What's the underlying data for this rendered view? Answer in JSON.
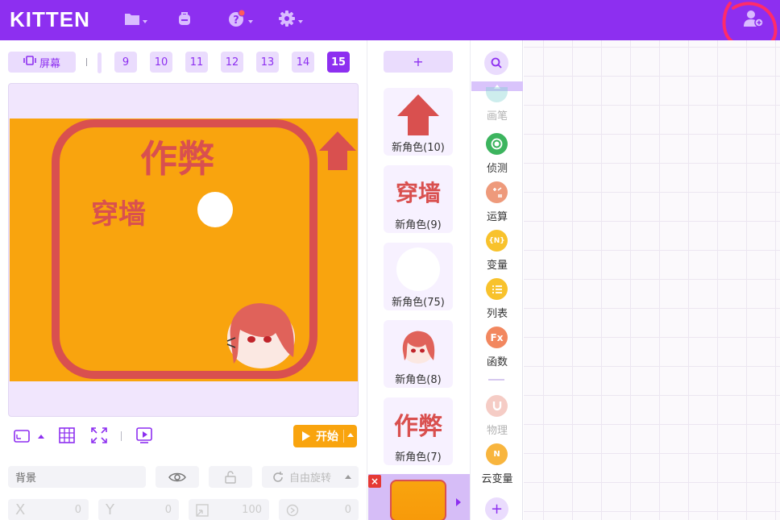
{
  "app": {
    "title": "KITTEN"
  },
  "colors": {
    "topbar": "#8d2ff0",
    "accent": "#8d2ff0",
    "stage_bg": "#f9a40e",
    "border_red": "#d9504f"
  },
  "toolbar": {
    "icons": [
      "folder-icon",
      "backpack-icon",
      "help-icon",
      "settings-icon"
    ],
    "user_icon": "add-collaborator-icon"
  },
  "scenes": {
    "screen_label": "屏幕",
    "tabs": [
      "9",
      "10",
      "11",
      "12",
      "13",
      "14",
      "15"
    ],
    "active": "15"
  },
  "stage": {
    "texts": {
      "cheat": "作弊",
      "wall": "穿墙"
    }
  },
  "controls": {
    "start_label": "开始"
  },
  "properties": {
    "name_value": "背景",
    "rotate_label": "自由旋转",
    "x_label": "X",
    "x_value": "0",
    "y_label": "Y",
    "y_value": "0",
    "size_value": "100",
    "dir_value": "0"
  },
  "sprites": {
    "add_label": "+",
    "items": [
      {
        "name": "新角色(10)",
        "icon": "red-arrow-icon"
      },
      {
        "name": "新角色(9)",
        "icon": "wall-text"
      },
      {
        "name": "新角色(75)",
        "icon": "white-circle-icon"
      },
      {
        "name": "新角色(8)",
        "icon": "anime-girl-icon"
      },
      {
        "name": "新角色(7)",
        "icon": "cheat-text"
      }
    ]
  },
  "categories": {
    "items": [
      {
        "label": "画笔",
        "color": "#7bcfcf",
        "faded": true
      },
      {
        "label": "侦测",
        "color": "#3cb45e",
        "faded": false
      },
      {
        "label": "运算",
        "color": "#ee9a7b",
        "faded": false
      },
      {
        "label": "变量",
        "color": "#f8c22c",
        "faded": false
      },
      {
        "label": "列表",
        "color": "#f8c22c",
        "faded": false
      },
      {
        "label": "函数",
        "color": "#f2875f",
        "faded": false
      },
      {
        "label": "物理",
        "color": "#e57a6a",
        "faded": true
      },
      {
        "label": "云变量",
        "color": "#f8b53e",
        "faded": false
      }
    ],
    "glyphs": {
      "variable": "{N}",
      "function": "Fx",
      "cloud": "N"
    }
  }
}
